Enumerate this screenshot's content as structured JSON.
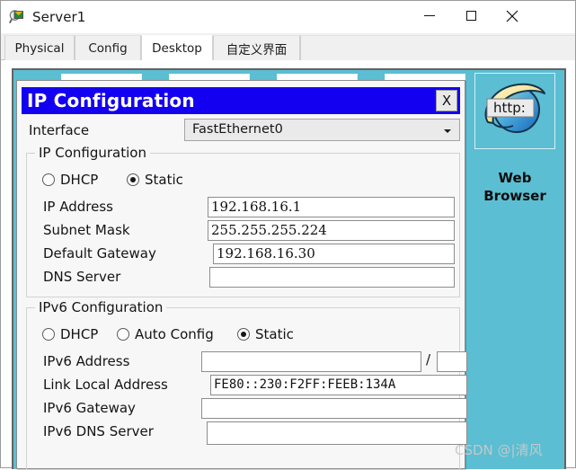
{
  "window": {
    "title": "Server1",
    "icon": "packet-tracer-device-icon",
    "controls": {
      "minimize": "–",
      "maximize": "☐",
      "close": "✕"
    }
  },
  "tabs": [
    {
      "label": "Physical",
      "active": false
    },
    {
      "label": "Config",
      "active": false
    },
    {
      "label": "Desktop",
      "active": true
    },
    {
      "label": "自定义界面",
      "active": false
    }
  ],
  "desktop": {
    "background_color": "#5bbed2",
    "web_browser": {
      "label_line1": "Web",
      "label_line2": "Browser",
      "icon": "web-browser-globe-icon",
      "badge_text": "http:"
    }
  },
  "dialog": {
    "title": "IP Configuration",
    "close_label": "X",
    "titlebar_color": "#1400f0",
    "interface": {
      "label": "Interface",
      "value": "FastEthernet0",
      "options": [
        "FastEthernet0"
      ]
    },
    "ipv4": {
      "group_title": "IP Configuration",
      "modes": [
        {
          "label": "DHCP",
          "selected": false
        },
        {
          "label": "Static",
          "selected": true
        }
      ],
      "fields": [
        {
          "label": "IP Address",
          "value": "192.168.16.1",
          "placeholder": ""
        },
        {
          "label": "Subnet Mask",
          "value": "255.255.255.224",
          "placeholder": ""
        },
        {
          "label": "Default Gateway",
          "value": "192.168.16.30",
          "placeholder": ""
        },
        {
          "label": "DNS Server",
          "value": "",
          "placeholder": ""
        }
      ]
    },
    "ipv6": {
      "group_title": "IPv6 Configuration",
      "modes": [
        {
          "label": "DHCP",
          "selected": false
        },
        {
          "label": "Auto Config",
          "selected": false
        },
        {
          "label": "Static",
          "selected": true
        }
      ],
      "address_label": "IPv6 Address",
      "address_value": "",
      "prefix_separator": "/",
      "prefix_value": "",
      "fields": [
        {
          "label": "Link Local Address",
          "value": "FE80::230:F2FF:FEEB:134A",
          "placeholder": ""
        },
        {
          "label": "IPv6 Gateway",
          "value": "",
          "placeholder": ""
        },
        {
          "label": "IPv6 DNS Server",
          "value": "",
          "placeholder": ""
        }
      ]
    }
  },
  "watermark": {
    "text": "CSDN @|清风"
  }
}
